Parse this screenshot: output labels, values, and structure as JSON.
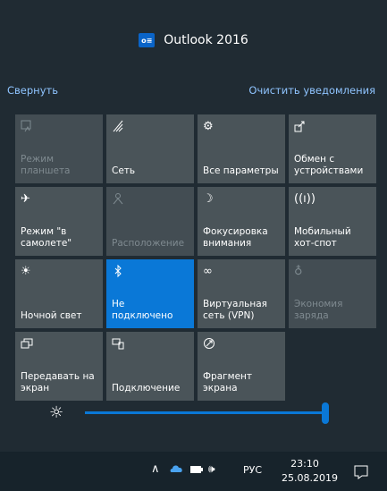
{
  "notification": {
    "app_icon": "outlook-icon",
    "app_icon_text": "o≡",
    "title": "Outlook 2016"
  },
  "links": {
    "collapse": "Свернуть",
    "clear": "Очистить уведомления"
  },
  "tiles": [
    {
      "label": "Режим\nпланшета",
      "icon": "tablet-mode-icon",
      "state": "disabled"
    },
    {
      "label": "Сеть",
      "icon": "network-icon",
      "state": "normal"
    },
    {
      "label": "Все параметры",
      "icon": "settings-icon",
      "state": "normal"
    },
    {
      "label": "Обмен с\nустройствами",
      "icon": "nearby-sharing-icon",
      "state": "normal"
    },
    {
      "label": "Режим \"в\nсамолете\"",
      "icon": "airplane-icon",
      "state": "normal"
    },
    {
      "label": "Расположение",
      "icon": "location-icon",
      "state": "disabled"
    },
    {
      "label": "Фокусировка\nвнимания",
      "icon": "focus-assist-icon",
      "state": "normal"
    },
    {
      "label": "Мобильный\nхот-спот",
      "icon": "hotspot-icon",
      "state": "normal"
    },
    {
      "label": "Ночной свет",
      "icon": "night-light-icon",
      "state": "normal"
    },
    {
      "label": "Не\nподключено",
      "icon": "bluetooth-icon",
      "state": "active"
    },
    {
      "label": "Виртуальная\nсеть (VPN)",
      "icon": "vpn-icon",
      "state": "normal"
    },
    {
      "label": "Экономия\nзаряда",
      "icon": "battery-saver-icon",
      "state": "disabled"
    },
    {
      "label": "Передавать на\nэкран",
      "icon": "project-icon",
      "state": "normal"
    },
    {
      "label": "Подключение",
      "icon": "connect-icon",
      "state": "normal"
    },
    {
      "label": "Фрагмент\nэкрана",
      "icon": "screen-snip-icon",
      "state": "normal"
    }
  ],
  "brightness": {
    "icon": "brightness-icon",
    "level": 1.0
  },
  "taskbar": {
    "language": "РУС",
    "time": "23:10",
    "date": "25.08.2019"
  },
  "colors": {
    "accent": "#0a78d7",
    "tile": "#4a5459",
    "background": "#202b33"
  }
}
